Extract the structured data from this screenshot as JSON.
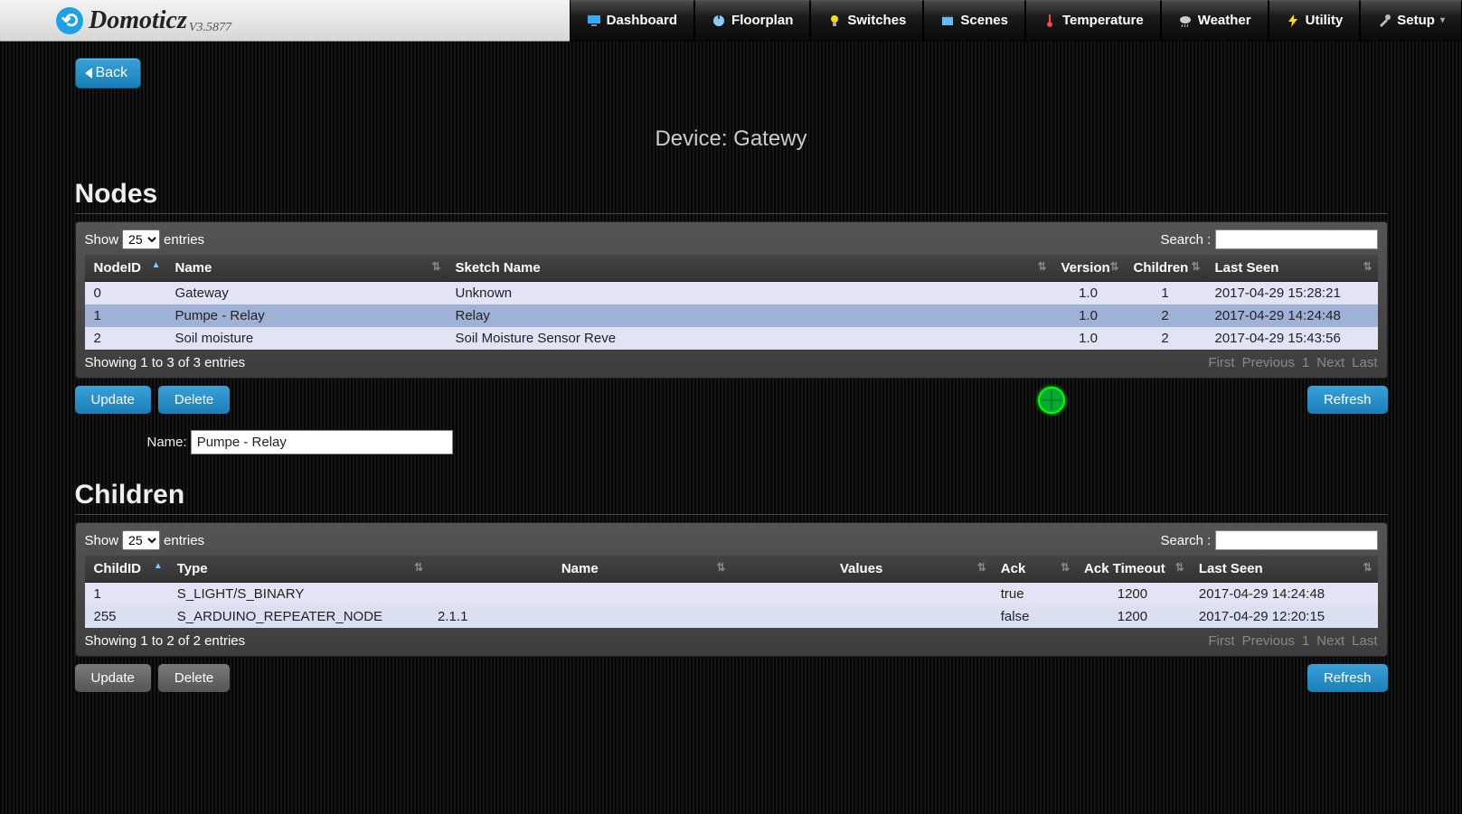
{
  "brand": {
    "name": "Domoticz",
    "version": "V3.5877"
  },
  "nav": {
    "dashboard": "Dashboard",
    "floorplan": "Floorplan",
    "switches": "Switches",
    "scenes": "Scenes",
    "temperature": "Temperature",
    "weather": "Weather",
    "utility": "Utility",
    "setup": "Setup"
  },
  "back_label": "Back",
  "page_title": "Device: Gatewy",
  "nodes": {
    "heading": "Nodes",
    "show_label": "Show",
    "entries_label": "entries",
    "page_size": "25",
    "search_label": "Search :",
    "cols": {
      "nodeid": "NodeID",
      "name": "Name",
      "sketch": "Sketch Name",
      "version": "Version",
      "children": "Children",
      "lastseen": "Last Seen"
    },
    "rows": [
      {
        "id": "0",
        "name": "Gateway",
        "sketch": "Unknown",
        "version": "1.0",
        "children": "1",
        "lastseen": "2017-04-29 15:28:21"
      },
      {
        "id": "1",
        "name": "Pumpe - Relay",
        "sketch": "Relay",
        "version": "1.0",
        "children": "2",
        "lastseen": "2017-04-29 14:24:48"
      },
      {
        "id": "2",
        "name": "Soil moisture",
        "sketch": "Soil Moisture Sensor Reve",
        "version": "1.0",
        "children": "2",
        "lastseen": "2017-04-29 15:43:56"
      }
    ],
    "info": "Showing 1 to 3 of 3 entries",
    "pager": {
      "first": "First",
      "prev": "Previous",
      "page": "1",
      "next": "Next",
      "last": "Last"
    },
    "update_btn": "Update",
    "delete_btn": "Delete",
    "refresh_btn": "Refresh"
  },
  "name_field": {
    "label": "Name:",
    "value": "Pumpe - Relay"
  },
  "children_tbl": {
    "heading": "Children",
    "show_label": "Show",
    "entries_label": "entries",
    "page_size": "25",
    "search_label": "Search :",
    "cols": {
      "childid": "ChildID",
      "type": "Type",
      "name": "Name",
      "values": "Values",
      "ack": "Ack",
      "ackto": "Ack Timeout",
      "lastseen": "Last Seen"
    },
    "rows": [
      {
        "id": "1",
        "type": "S_LIGHT/S_BINARY",
        "name": "",
        "vals": "",
        "ack": "true",
        "ackto": "1200",
        "lastseen": "2017-04-29 14:24:48"
      },
      {
        "id": "255",
        "type": "S_ARDUINO_REPEATER_NODE",
        "name": "2.1.1",
        "vals": "",
        "ack": "false",
        "ackto": "1200",
        "lastseen": "2017-04-29 12:20:15"
      }
    ],
    "info": "Showing 1 to 2 of 2 entries",
    "pager": {
      "first": "First",
      "prev": "Previous",
      "page": "1",
      "next": "Next",
      "last": "Last"
    },
    "update_btn": "Update",
    "delete_btn": "Delete",
    "refresh_btn": "Refresh"
  }
}
